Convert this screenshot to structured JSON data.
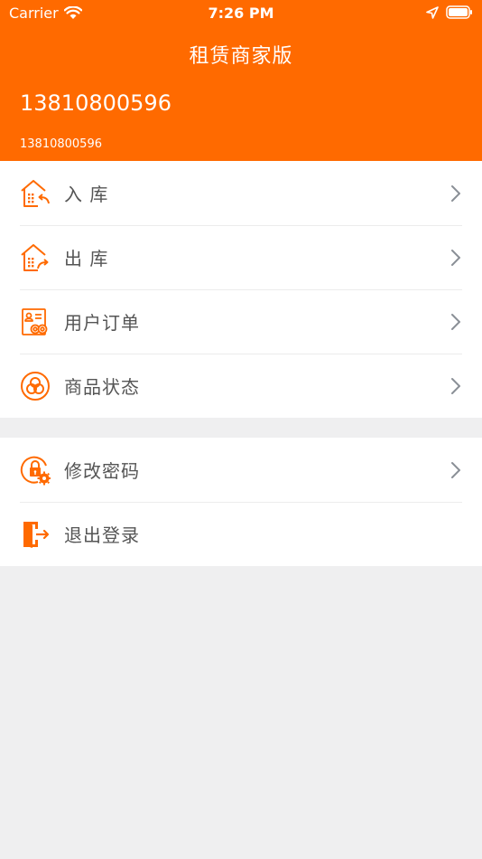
{
  "status_bar": {
    "carrier": "Carrier",
    "time": "7:26 PM",
    "icons": [
      "wifi-icon",
      "location-arrow-icon",
      "battery-icon"
    ]
  },
  "header": {
    "title": "租赁商家版",
    "phone_primary": "13810800596",
    "phone_secondary": "13810800596"
  },
  "menu_group_1": [
    {
      "label": "入 库",
      "icon": "warehouse-in-icon",
      "has_chevron": true
    },
    {
      "label": "出 库",
      "icon": "warehouse-out-icon",
      "has_chevron": true
    },
    {
      "label": "用户订单",
      "icon": "user-order-icon",
      "has_chevron": true
    },
    {
      "label": "商品状态",
      "icon": "product-status-icon",
      "has_chevron": true
    }
  ],
  "menu_group_2": [
    {
      "label": "修改密码",
      "icon": "change-password-icon",
      "has_chevron": true
    },
    {
      "label": "退出登录",
      "icon": "logout-icon",
      "has_chevron": false
    }
  ],
  "colors": {
    "accent": "#ff6a00",
    "background": "#efeff0",
    "text": "#555555",
    "chevron": "#8a8f96"
  }
}
